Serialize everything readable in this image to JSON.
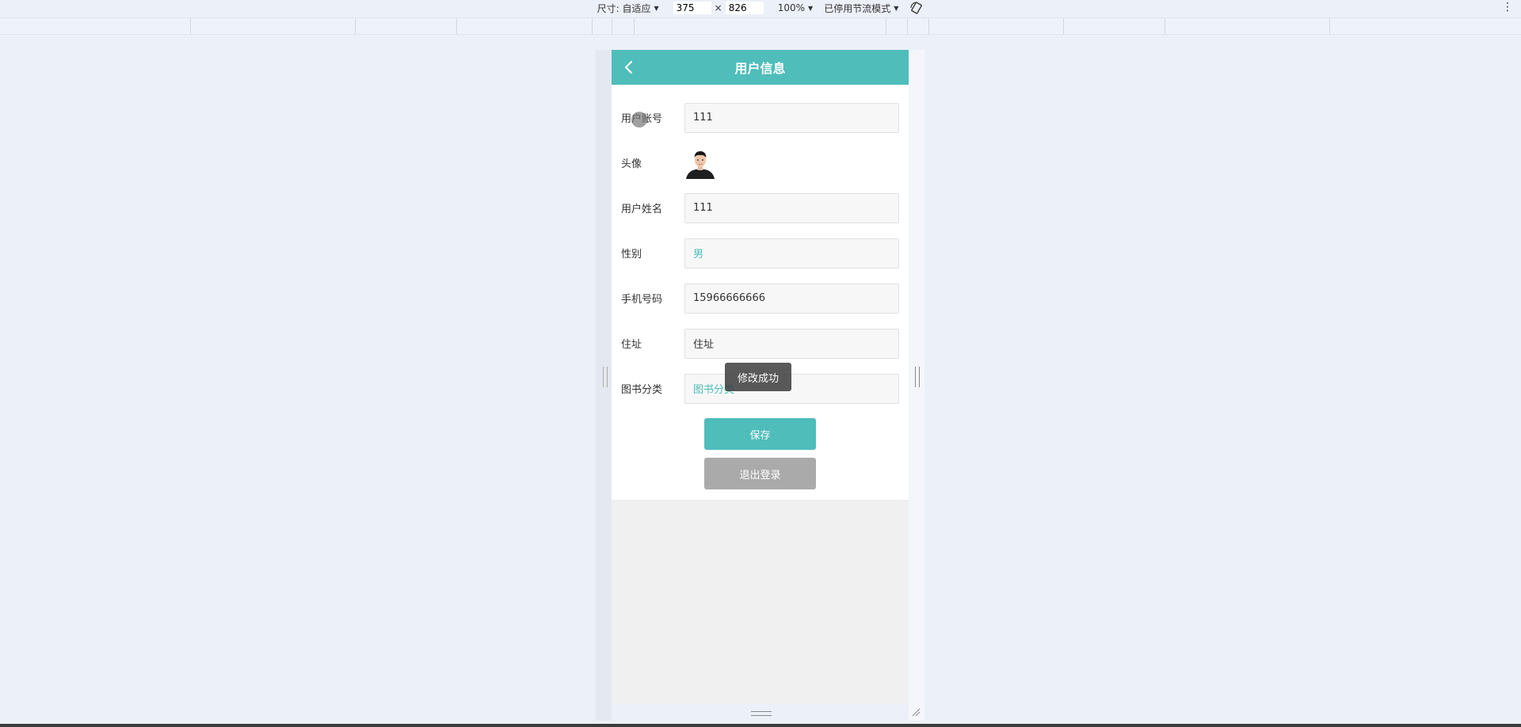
{
  "devtools": {
    "size_label": "尺寸: 自适应",
    "width_value": "375",
    "times": "×",
    "height_value": "826",
    "zoom": "100%",
    "throttle": "已停用节流模式"
  },
  "header": {
    "title": "用户信息"
  },
  "form": {
    "account_label": "用户账号",
    "account_value": "111",
    "avatar_label": "头像",
    "name_label": "用户姓名",
    "name_value": "111",
    "gender_label": "性别",
    "gender_value": "男",
    "phone_label": "手机号码",
    "phone_value": "15966666666",
    "address_label": "住址",
    "address_value": "住址",
    "category_label": "图书分类",
    "category_value": "图书分类"
  },
  "buttons": {
    "save": "保存",
    "logout": "退出登录"
  },
  "toast": {
    "message": "修改成功"
  },
  "colors": {
    "accent": "#4fbdba",
    "logout_button": "#aaaaaa",
    "page_background": "#f0f0f0"
  }
}
